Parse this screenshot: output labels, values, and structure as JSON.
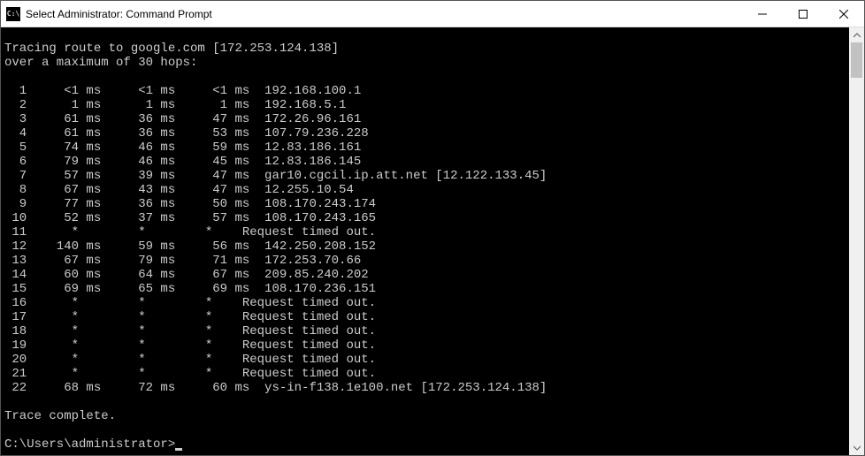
{
  "titlebar": {
    "icon_label": "C:\\",
    "title": "Select Administrator: Command Prompt"
  },
  "header": {
    "line1": "Tracing route to google.com [172.253.124.138]",
    "line2": "over a maximum of 30 hops:"
  },
  "hops": [
    {
      "n": "1",
      "t1": "<1 ms",
      "t2": "<1 ms",
      "t3": "<1 ms",
      "host": "192.168.100.1"
    },
    {
      "n": "2",
      "t1": "1 ms",
      "t2": "1 ms",
      "t3": "1 ms",
      "host": "192.168.5.1"
    },
    {
      "n": "3",
      "t1": "61 ms",
      "t2": "36 ms",
      "t3": "47 ms",
      "host": "172.26.96.161"
    },
    {
      "n": "4",
      "t1": "61 ms",
      "t2": "36 ms",
      "t3": "53 ms",
      "host": "107.79.236.228"
    },
    {
      "n": "5",
      "t1": "74 ms",
      "t2": "46 ms",
      "t3": "59 ms",
      "host": "12.83.186.161"
    },
    {
      "n": "6",
      "t1": "79 ms",
      "t2": "46 ms",
      "t3": "45 ms",
      "host": "12.83.186.145"
    },
    {
      "n": "7",
      "t1": "57 ms",
      "t2": "39 ms",
      "t3": "47 ms",
      "host": "gar10.cgcil.ip.att.net [12.122.133.45]"
    },
    {
      "n": "8",
      "t1": "67 ms",
      "t2": "43 ms",
      "t3": "47 ms",
      "host": "12.255.10.54"
    },
    {
      "n": "9",
      "t1": "77 ms",
      "t2": "36 ms",
      "t3": "50 ms",
      "host": "108.170.243.174"
    },
    {
      "n": "10",
      "t1": "52 ms",
      "t2": "37 ms",
      "t3": "57 ms",
      "host": "108.170.243.165"
    },
    {
      "n": "11",
      "t1": "*",
      "t2": "*",
      "t3": "*",
      "host": "Request timed out."
    },
    {
      "n": "12",
      "t1": "140 ms",
      "t2": "59 ms",
      "t3": "56 ms",
      "host": "142.250.208.152"
    },
    {
      "n": "13",
      "t1": "67 ms",
      "t2": "79 ms",
      "t3": "71 ms",
      "host": "172.253.70.66"
    },
    {
      "n": "14",
      "t1": "60 ms",
      "t2": "64 ms",
      "t3": "67 ms",
      "host": "209.85.240.202"
    },
    {
      "n": "15",
      "t1": "69 ms",
      "t2": "65 ms",
      "t3": "69 ms",
      "host": "108.170.236.151"
    },
    {
      "n": "16",
      "t1": "*",
      "t2": "*",
      "t3": "*",
      "host": "Request timed out."
    },
    {
      "n": "17",
      "t1": "*",
      "t2": "*",
      "t3": "*",
      "host": "Request timed out."
    },
    {
      "n": "18",
      "t1": "*",
      "t2": "*",
      "t3": "*",
      "host": "Request timed out."
    },
    {
      "n": "19",
      "t1": "*",
      "t2": "*",
      "t3": "*",
      "host": "Request timed out."
    },
    {
      "n": "20",
      "t1": "*",
      "t2": "*",
      "t3": "*",
      "host": "Request timed out."
    },
    {
      "n": "21",
      "t1": "*",
      "t2": "*",
      "t3": "*",
      "host": "Request timed out."
    },
    {
      "n": "22",
      "t1": "68 ms",
      "t2": "72 ms",
      "t3": "60 ms",
      "host": "ys-in-f138.1e100.net [172.253.124.138]"
    }
  ],
  "footer": {
    "complete": "Trace complete.",
    "prompt": "C:\\Users\\administrator>"
  }
}
